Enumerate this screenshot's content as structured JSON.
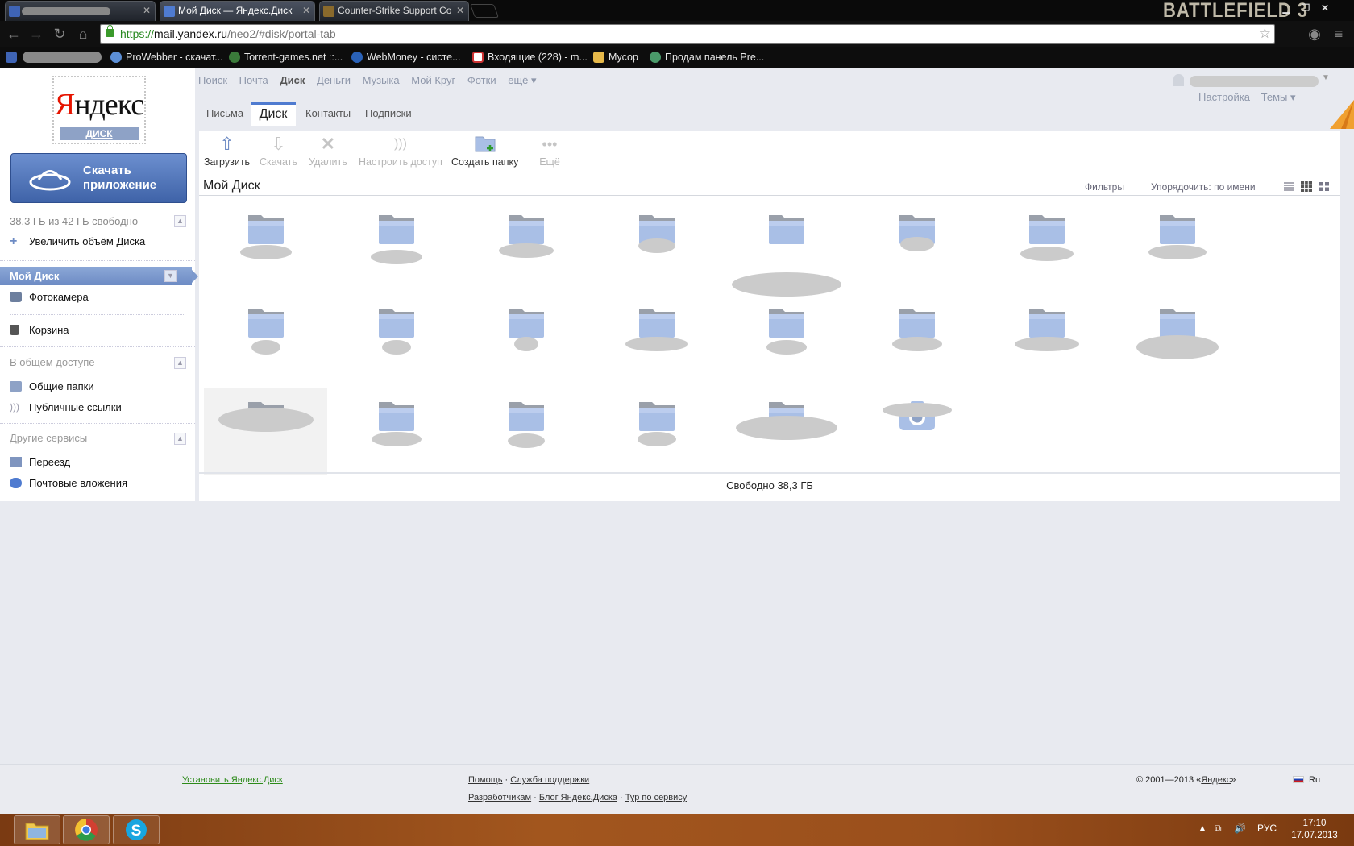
{
  "browser": {
    "tabs": [
      {
        "title": "",
        "active": false
      },
      {
        "title": "Мой Диск — Яндекс.Диск",
        "active": true
      },
      {
        "title": "Counter-Strike Support Co",
        "active": false
      }
    ],
    "brand_overlay": "BATTLEFIELD 3",
    "url": {
      "scheme": "https://",
      "host": "mail.yandex.ru",
      "path": "/neo2/#disk/portal-tab"
    },
    "bookmarks": [
      {
        "label": "ProWebber - скачат...",
        "icon": "prowebber-icon"
      },
      {
        "label": "Torrent-games.net ::...",
        "icon": "torrent-games-icon"
      },
      {
        "label": "WebMoney - систе...",
        "icon": "webmoney-icon"
      },
      {
        "label": "Входящие (228) - m...",
        "icon": "gmail-icon"
      },
      {
        "label": "Мусор",
        "icon": "folder-icon"
      },
      {
        "label": "Продам панель Pre...",
        "icon": "forum-icon"
      }
    ]
  },
  "logo": {
    "word_first": "Я",
    "word_rest": "ндекс",
    "sub": "ДИСК"
  },
  "download_app": {
    "line1": "Скачать",
    "line2": "приложение"
  },
  "sidebar": {
    "quota": "38,3 ГБ из 42 ГБ свободно",
    "increase": "Увеличить объём Диска",
    "my_disk": "Мой Диск",
    "camera": "Фотокамера",
    "trash": "Корзина",
    "shared_title": "В общем доступе",
    "shared_folders": "Общие папки",
    "public_links": "Публичные ссылки",
    "other_title": "Другие сервисы",
    "move": "Переезд",
    "attachments": "Почтовые вложения"
  },
  "topnav": {
    "items": [
      "Поиск",
      "Почта",
      "Диск",
      "Деньги",
      "Музыка",
      "Мой Круг",
      "Фотки",
      "ещё ▾"
    ],
    "current": "Диск",
    "settings": "Настройка",
    "themes": "Темы ▾"
  },
  "subtabs": {
    "letters": "Письма",
    "disk": "Диск",
    "contacts": "Контакты",
    "subscriptions": "Подписки"
  },
  "toolbar": {
    "upload": "Загрузить",
    "download": "Скачать",
    "delete": "Удалить",
    "access": "Настроить доступ",
    "new_folder": "Создать папку",
    "more": "Ещё"
  },
  "content": {
    "breadcrumb": "Мой Диск",
    "filters": "Фильтры",
    "sort_label": "Упорядочить:",
    "sort_value": "по имени",
    "items": [
      {
        "type": "folder",
        "name": ""
      },
      {
        "type": "folder",
        "name": ""
      },
      {
        "type": "folder",
        "name": ""
      },
      {
        "type": "folder",
        "name": ""
      },
      {
        "type": "folder",
        "name": ""
      },
      {
        "type": "folder",
        "name": ""
      },
      {
        "type": "folder",
        "name": ""
      },
      {
        "type": "folder",
        "name": ""
      },
      {
        "type": "folder",
        "name": ""
      },
      {
        "type": "folder",
        "name": ""
      },
      {
        "type": "folder",
        "name": ""
      },
      {
        "type": "folder",
        "name": ""
      },
      {
        "type": "folder",
        "name": ""
      },
      {
        "type": "folder",
        "name": ""
      },
      {
        "type": "folder",
        "name": ""
      },
      {
        "type": "folder",
        "name": ""
      },
      {
        "type": "folder",
        "name": "",
        "selected": true
      },
      {
        "type": "folder",
        "name": ""
      },
      {
        "type": "folder",
        "name": ""
      },
      {
        "type": "folder",
        "name": ""
      },
      {
        "type": "folder",
        "name": ""
      },
      {
        "type": "camera-folder",
        "name": ""
      }
    ],
    "free": "Свободно 38,3 ГБ"
  },
  "footer": {
    "install": "Установить Яндекс.Диск",
    "help": "Помощь",
    "support": "Служба поддержки",
    "dev": "Разработчикам",
    "blog": "Блог Яндекс.Диска",
    "tour": "Тур по сервису",
    "copyright_prefix": "© 2001—2013 «",
    "copyright_link": "Яндекс",
    "copyright_suffix": "»",
    "lang": "Ru"
  },
  "taskbar": {
    "apps": [
      "explorer-icon",
      "chrome-icon",
      "skype-icon"
    ],
    "lang": "РУС",
    "time": "17:10",
    "date": "17.07.2013"
  },
  "colors": {
    "accent": "#4f7bd0",
    "folder": "#a9bfe6",
    "logo_red": "#e61400",
    "link_green": "#2d8b1a"
  }
}
